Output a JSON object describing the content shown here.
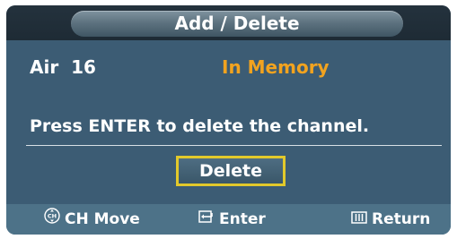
{
  "dialog": {
    "title": "Add / Delete",
    "channel": "Air  16",
    "status": "In Memory",
    "message": "Press ENTER to delete the channel.",
    "action_label": "Delete"
  },
  "footer": {
    "move_label": "CH Move",
    "move_icon": "ch-icon",
    "enter_label": "Enter",
    "enter_icon": "enter-icon",
    "return_label": "Return",
    "return_icon": "return-icon"
  },
  "colors": {
    "panel": "#3c5c74",
    "status": "#f2a31f",
    "focus_border": "#e2c92b",
    "footer": "#4d7288"
  }
}
